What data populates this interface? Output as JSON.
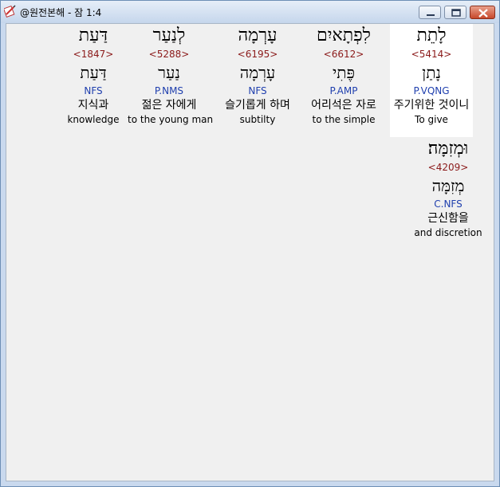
{
  "window": {
    "title": "@원전본해 - 잠 1:4",
    "minimize_icon": "minimize-icon",
    "maximize_icon": "maximize-icon",
    "close_icon": "close-icon",
    "app_icon": "bible-app-icon"
  },
  "colors": {
    "strong_number": "#8b1a1a",
    "morphology": "#1f3fae",
    "selected_background": "#ffffff",
    "client_background": "#f0f0f0"
  },
  "words": [
    {
      "hebrew": "לָתֵת",
      "strong": "<5414>",
      "lemma": "נָתַן",
      "morph": "P.VQNG",
      "korean": "주기위한 것이니",
      "english": "To give",
      "selected": true
    },
    {
      "hebrew": "לִפְתָאיִם",
      "strong": "<6612>",
      "lemma": "פֶּתִי",
      "morph": "P.AMP",
      "korean": "어리석은 자로",
      "english": "to the simple",
      "selected": false
    },
    {
      "hebrew": "עָרְמָה",
      "strong": "<6195>",
      "lemma": "עָרְמָה",
      "morph": "NFS",
      "korean": "슬기롭게 하며",
      "english": "subtilty",
      "selected": false
    },
    {
      "hebrew": "לְנַעַר",
      "strong": "<5288>",
      "lemma": "נַעַר",
      "morph": "P.NMS",
      "korean": "젊은 자에게",
      "english": "to the young man",
      "selected": false
    },
    {
      "hebrew": "דַּעַת",
      "strong": "<1847>",
      "lemma": "דַּעַת",
      "morph": "NFS",
      "korean": "지식과",
      "english": "knowledge",
      "selected": false
    },
    {
      "hebrew": "וּמְזִמָּה׃",
      "strong": "<4209>",
      "lemma": "מְזִמָּה",
      "morph": "C.NFS",
      "korean": "근신함을",
      "english": "and discretion",
      "selected": false
    }
  ]
}
